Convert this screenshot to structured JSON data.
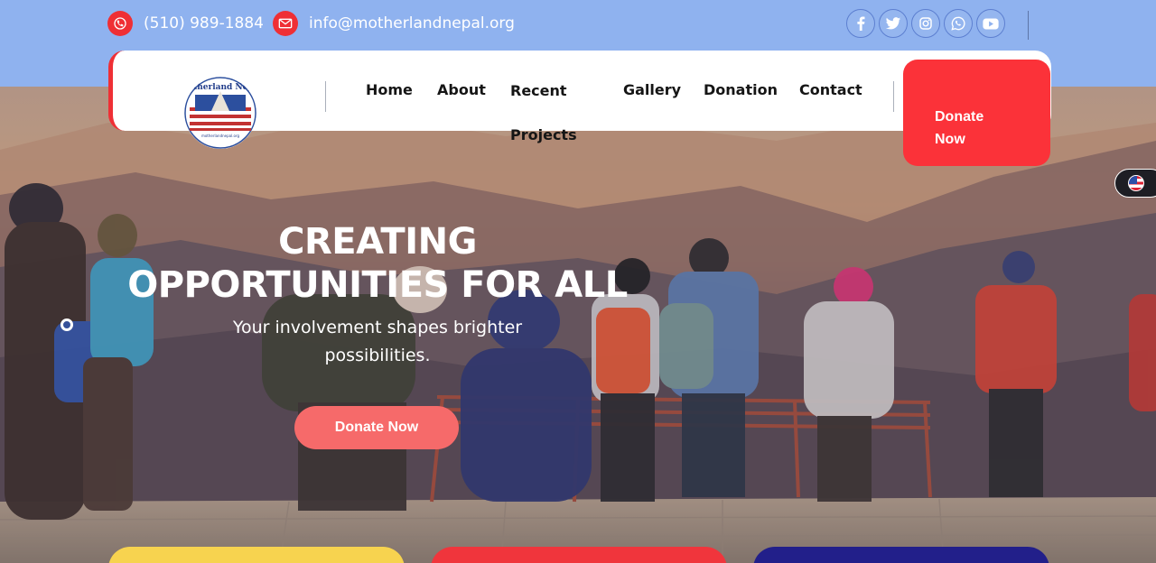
{
  "topbar": {
    "phone": "(510) 989-1884",
    "email": "info@motherlandnepal.org",
    "social": [
      "facebook-icon",
      "twitter-icon",
      "instagram-icon",
      "whatsapp-icon",
      "youtube-icon"
    ]
  },
  "header": {
    "logo_text": "Motherland Nepal",
    "logo_url_text": "motherlandnepal.org",
    "nav": [
      "Home",
      "About",
      "Recent Projects",
      "Gallery",
      "Donation",
      "Contact"
    ],
    "donate_label": "Donate Now"
  },
  "hero": {
    "title": "CREATING OPPORTUNITIES FOR ALL",
    "subtitle": "Your involvement shapes brighter possibilities.",
    "button_label": "Donate Now"
  },
  "colors": {
    "topbar": "#8fb2ef",
    "accent_red": "#fb3239",
    "hero_button": "#f66a6a",
    "card_yellow": "#f7d34f",
    "card_red": "#f0353c",
    "card_navy": "#221f8a"
  }
}
